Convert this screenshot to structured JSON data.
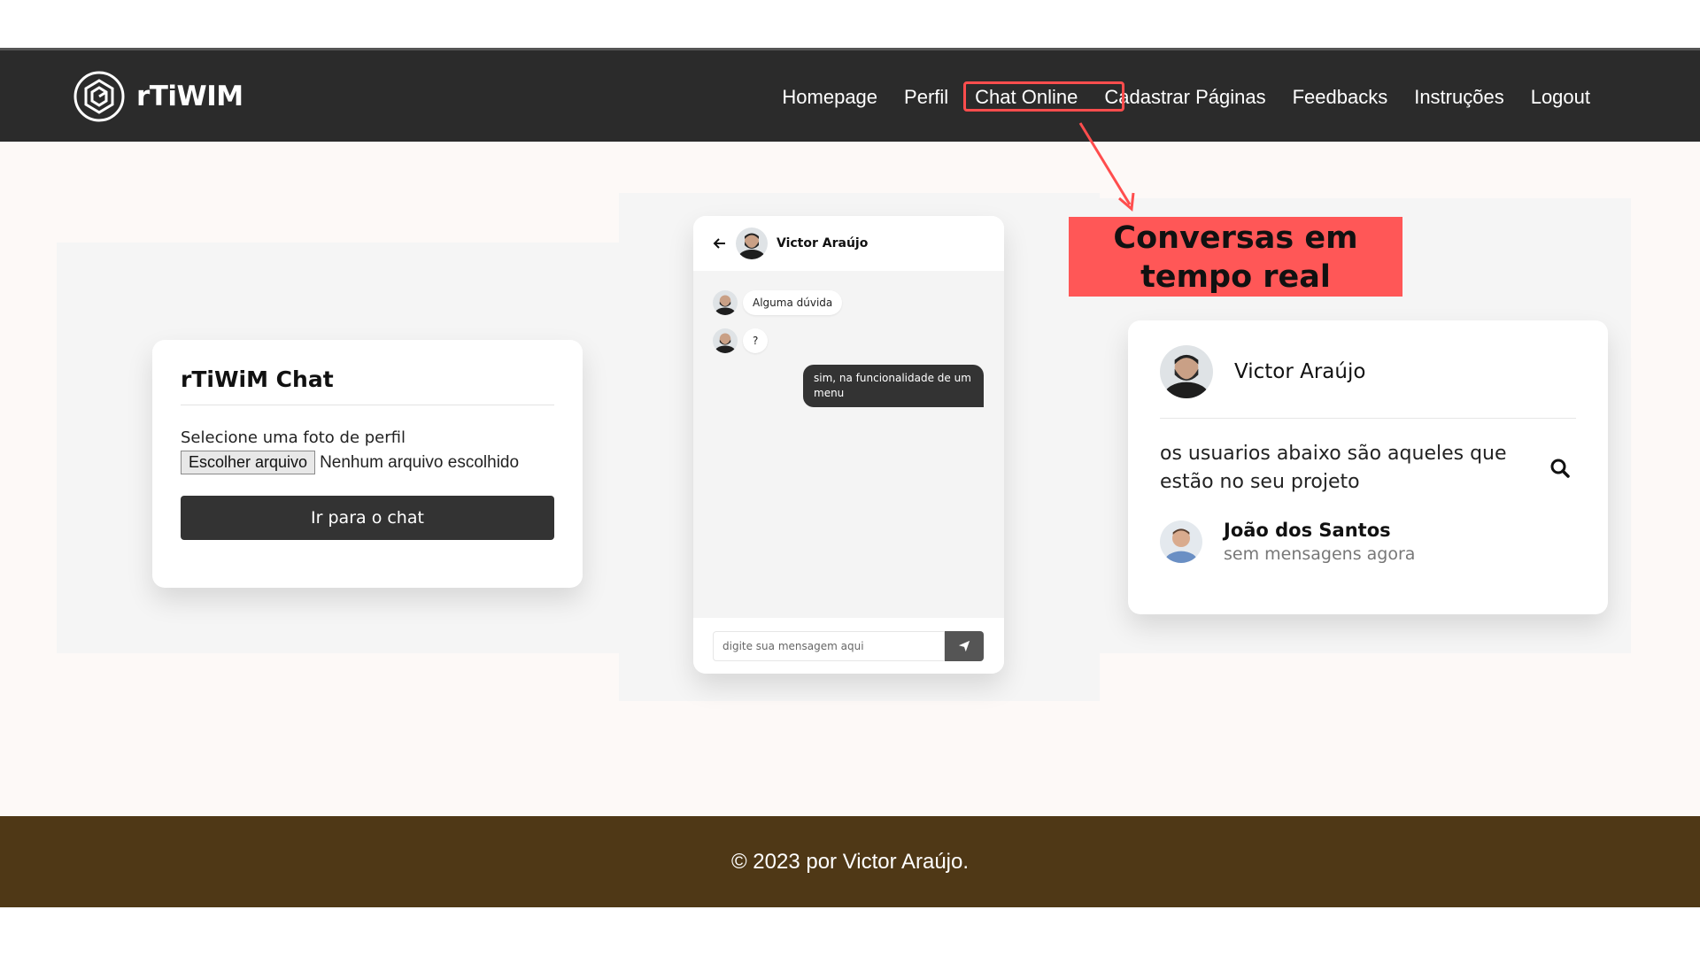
{
  "brand": {
    "name": "rTiWIM"
  },
  "nav": {
    "items": [
      "Homepage",
      "Perfil",
      "Chat Online",
      "Cadastrar Páginas",
      "Feedbacks",
      "Instruções",
      "Logout"
    ]
  },
  "callout": {
    "line1": "Conversas em",
    "line2": "tempo real"
  },
  "login_card": {
    "title": "rTiWiM Chat",
    "label": "Selecione uma foto de perfil",
    "file_button": "Escolher arquivo",
    "file_status": "Nenhum arquivo escolhido",
    "submit": "Ir para o chat"
  },
  "chat": {
    "contact": "Victor Araújo",
    "messages": [
      {
        "from": "them",
        "text": "Alguma dúvida"
      },
      {
        "from": "them",
        "text": "?"
      },
      {
        "from": "me",
        "text": "sim, na funcionalidade de um menu"
      }
    ],
    "input_placeholder": "digite sua mensagem aqui"
  },
  "users_card": {
    "name": "Victor Araújo",
    "description": "os usuarios abaixo são aqueles que estão no seu projeto",
    "users": [
      {
        "name": "João dos Santos",
        "status": "sem mensagens agora"
      }
    ]
  },
  "footer": {
    "text": "© 2023 por Victor Araújo."
  },
  "colors": {
    "navbar": "#2b2b2b",
    "accent": "#ff5757",
    "footer": "#4f3816",
    "button": "#333333"
  }
}
